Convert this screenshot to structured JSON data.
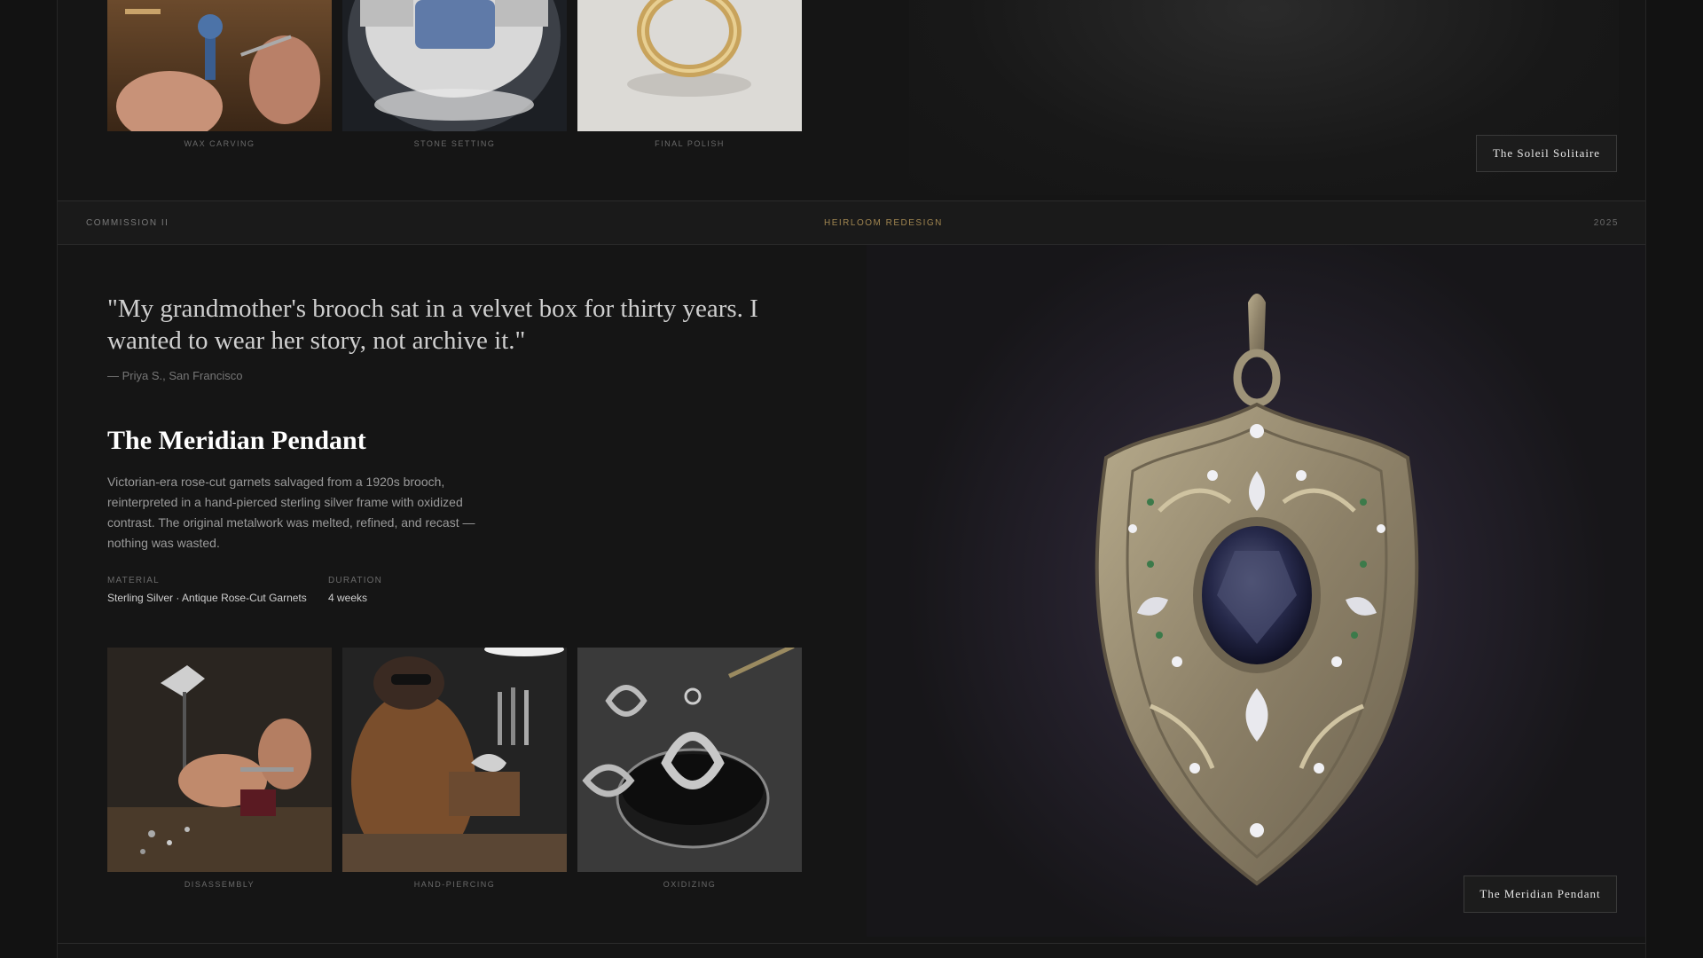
{
  "section1": {
    "process_captions": [
      "WAX CARVING",
      "STONE SETTING",
      "FINAL POLISH"
    ],
    "title_button": "The Soleil Solitaire"
  },
  "commission_bar": {
    "label": "COMMISSION II",
    "category": "HEIRLOOM REDESIGN",
    "year": "2025"
  },
  "section2": {
    "quote": "\"My grandmother's brooch sat in a velvet box for thirty years. I wanted to wear her story, not archive it.\"",
    "attribution": "— Priya S., San Francisco",
    "heading": "The Meridian Pendant",
    "description": "Victorian-era rose-cut garnets salvaged from a 1920s brooch, reinterpreted in a hand-pierced sterling silver frame with oxidized contrast. The original metalwork was melted, refined, and recast — nothing was wasted.",
    "material_label": "MATERIAL",
    "material_value": "Sterling Silver · Antique Rose-Cut Garnets",
    "duration_label": "DURATION",
    "duration_value": "4 weeks",
    "process_captions": [
      "DISASSEMBLY",
      "HAND-PIERCING",
      "OXIDIZING"
    ],
    "title_button": "The Meridian Pendant"
  },
  "colors": {
    "accent_gold": "#a08550",
    "background": "#151515",
    "button_bg": "#1c1c1c"
  }
}
